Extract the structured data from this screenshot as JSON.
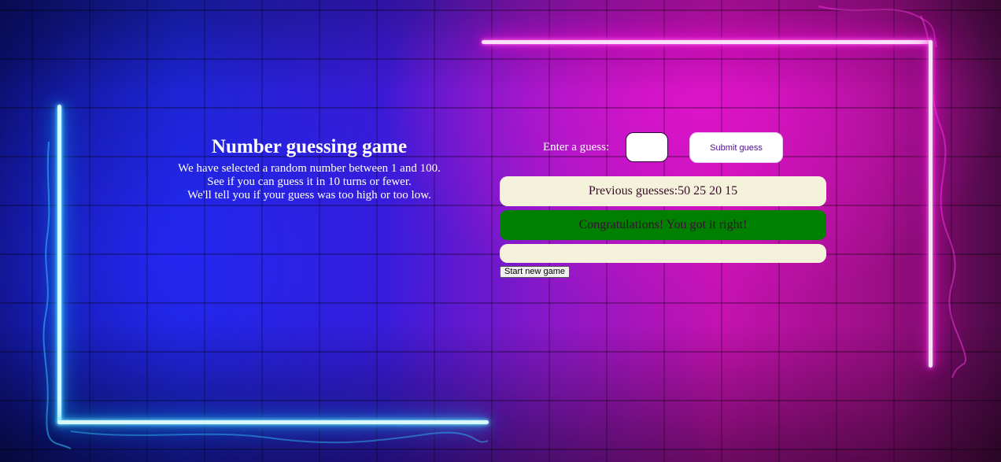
{
  "intro": {
    "title": "Number guessing game",
    "line1": "We have selected a random number between 1 and 100.",
    "line2": "See if you can guess it in 10 turns or fewer.",
    "line3": "We'll tell you if your guess was too high or too low."
  },
  "form": {
    "label": "Enter a guess:",
    "guess_value": "",
    "submit_label": "Submit guess"
  },
  "status": {
    "guesses_label": "Previous guesses:",
    "guesses_value": "50 25 20 15",
    "result": "Congratulations! You got it right!",
    "result_color": "#008000",
    "hint": ""
  },
  "controls": {
    "new_game_label": "Start new game"
  },
  "theme": {
    "neon_blue": "#2fd5ff",
    "neon_pink": "#ff14d8",
    "panel_bg": "#f5f2dc"
  }
}
